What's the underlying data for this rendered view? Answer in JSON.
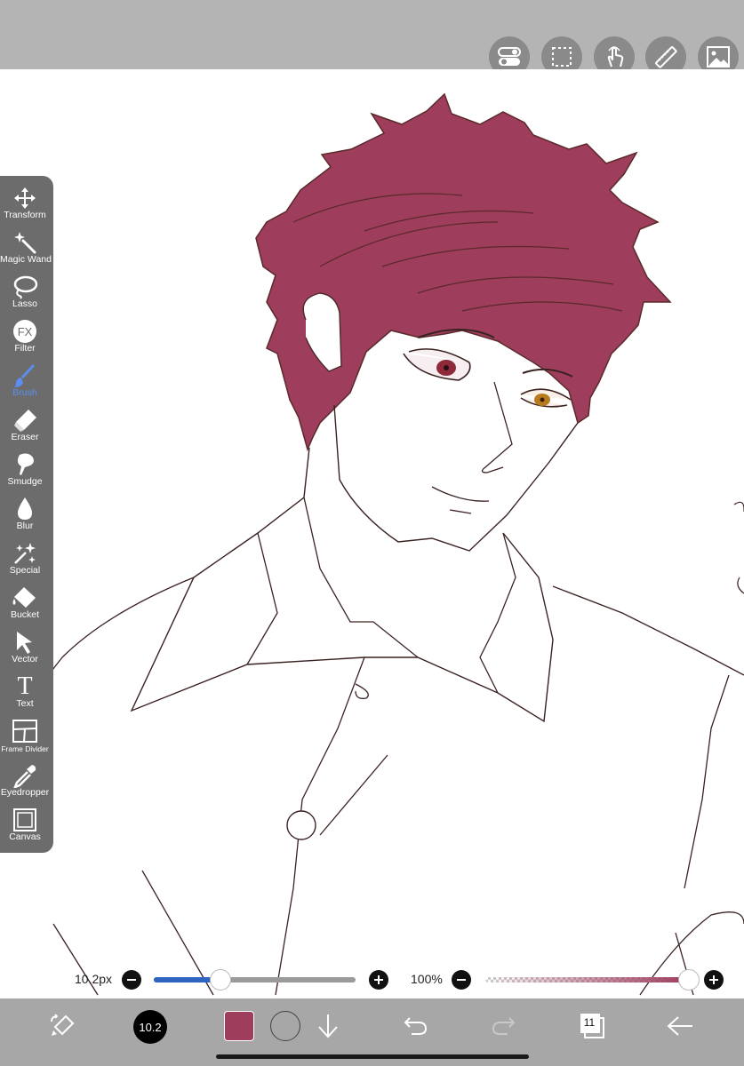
{
  "app": {
    "brush_color": "#9e3d5c",
    "accent": "#5b8ef2"
  },
  "top_toolbar": {
    "buttons": [
      {
        "name": "toggle-icon"
      },
      {
        "name": "selection-icon"
      },
      {
        "name": "touch-gesture-icon"
      },
      {
        "name": "ruler-icon"
      },
      {
        "name": "image-icon"
      }
    ]
  },
  "tools": [
    {
      "label": "Transform",
      "icon": "move-arrows-icon"
    },
    {
      "label": "Magic Wand",
      "icon": "magic-wand-icon"
    },
    {
      "label": "Lasso",
      "icon": "lasso-icon"
    },
    {
      "label": "Filter",
      "icon": "fx-icon",
      "icon_text": "FX"
    },
    {
      "label": "Brush",
      "icon": "brush-icon",
      "active": true
    },
    {
      "label": "Eraser",
      "icon": "eraser-icon"
    },
    {
      "label": "Smudge",
      "icon": "smudge-icon"
    },
    {
      "label": "Blur",
      "icon": "drop-icon"
    },
    {
      "label": "Special",
      "icon": "sparkle-icon"
    },
    {
      "label": "Bucket",
      "icon": "bucket-icon"
    },
    {
      "label": "Vector",
      "icon": "pointer-icon"
    },
    {
      "label": "Text",
      "icon": "text-icon",
      "icon_text": "T"
    },
    {
      "label": "Frame Divider",
      "icon": "frame-divider-icon"
    },
    {
      "label": "Eyedropper",
      "icon": "eyedropper-icon"
    },
    {
      "label": "Canvas",
      "icon": "canvas-icon"
    }
  ],
  "brush_size": {
    "label": "10.2px",
    "value_fraction": 0.33
  },
  "opacity": {
    "label": "100%",
    "value_fraction": 1.0
  },
  "bottom_toolbar": {
    "brush_size_badge": "10.2",
    "layer_count": "11"
  }
}
